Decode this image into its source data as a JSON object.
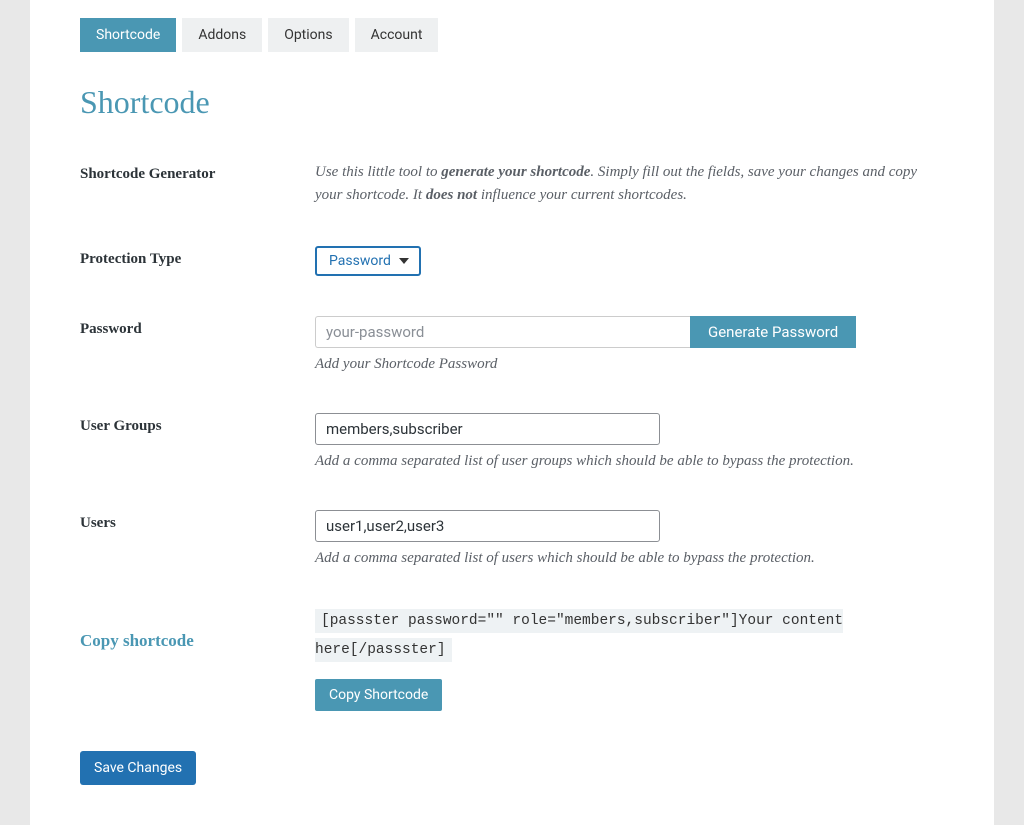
{
  "tabs": [
    {
      "label": "Shortcode",
      "active": true
    },
    {
      "label": "Addons",
      "active": false
    },
    {
      "label": "Options",
      "active": false
    },
    {
      "label": "Account",
      "active": false
    }
  ],
  "page_title": "Shortcode",
  "generator": {
    "label": "Shortcode Generator",
    "intro_pre": "Use this little tool to ",
    "intro_bold1": "generate your shortcode",
    "intro_mid": ". Simply fill out the fields, save your changes and copy your shortcode. It ",
    "intro_bold2": "does not",
    "intro_post": " influence your current shortcodes."
  },
  "protection": {
    "label": "Protection Type",
    "selected": "Password"
  },
  "password": {
    "label": "Password",
    "placeholder": "your-password",
    "value": "",
    "button": "Generate Password",
    "hint": "Add your Shortcode Password"
  },
  "usergroups": {
    "label": "User Groups",
    "value": "members,subscriber",
    "hint": "Add a comma separated list of user groups which should be able to bypass the protection."
  },
  "users": {
    "label": "Users",
    "value": "user1,user2,user3",
    "hint": "Add a comma separated list of users which should be able to bypass the protection."
  },
  "copy": {
    "label": "Copy shortcode",
    "shortcode": "[passster password=\"\" role=\"members,subscriber\"]Your content here[/passster]",
    "button": "Copy Shortcode"
  },
  "save_button": "Save Changes"
}
